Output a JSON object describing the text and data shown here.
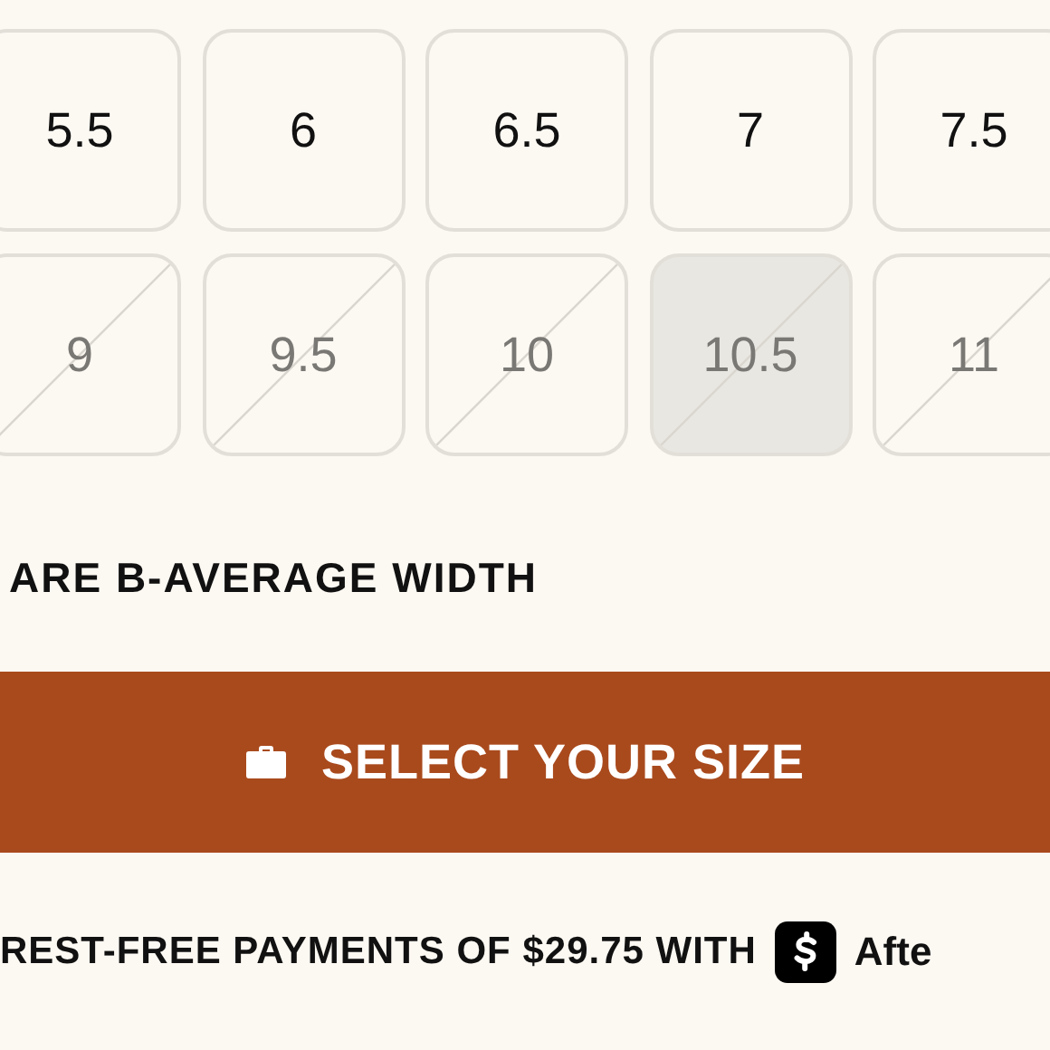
{
  "size_grid": [
    {
      "label": "5.5",
      "available": true,
      "selected": false
    },
    {
      "label": "6",
      "available": true,
      "selected": false
    },
    {
      "label": "6.5",
      "available": true,
      "selected": false
    },
    {
      "label": "7",
      "available": true,
      "selected": false
    },
    {
      "label": "7.5",
      "available": true,
      "selected": false
    },
    {
      "label": "9",
      "available": false,
      "selected": false
    },
    {
      "label": "9.5",
      "available": false,
      "selected": false
    },
    {
      "label": "10",
      "available": false,
      "selected": false
    },
    {
      "label": "10.5",
      "available": false,
      "selected": true
    },
    {
      "label": "11",
      "available": false,
      "selected": false
    }
  ],
  "width_note": "ARE B-AVERAGE WIDTH",
  "select_button": {
    "label": "SELECT YOUR SIZE"
  },
  "payment_note": {
    "text": "REST-FREE PAYMENTS OF $29.75 WITH",
    "provider": "Afte"
  }
}
